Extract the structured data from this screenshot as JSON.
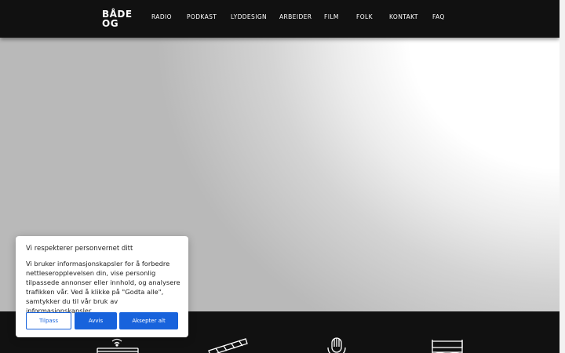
{
  "header": {
    "logo_line1": "BÅDE",
    "logo_line2": "OG",
    "nav": [
      "RADIO",
      "PODKAST",
      "LYDDESIGN",
      "ARBEIDER",
      "FILM",
      "FOLK",
      "KONTAKT",
      "FAQ"
    ]
  },
  "footer": {
    "icons": [
      "radio-icon",
      "clapperboard-icon",
      "microphone-icon",
      "director-chair-icon"
    ]
  },
  "cookie_banner": {
    "title": "Vi respekterer personvernet ditt",
    "text": "Vi bruker informasjonskapsler for å forbedre nettleseropplevelsen din, vise personlig tilpassede annonser eller innhold, og analysere trafikken vår. Ved å klikke på \"Godta alle\", samtykker du til vår bruk av informasjonskapsler.",
    "customize_label": "Tilpass",
    "reject_label": "Avvis",
    "accept_label": "Aksepter alt"
  },
  "colors": {
    "header_bg": "#111111",
    "accent": "#1863dc"
  }
}
